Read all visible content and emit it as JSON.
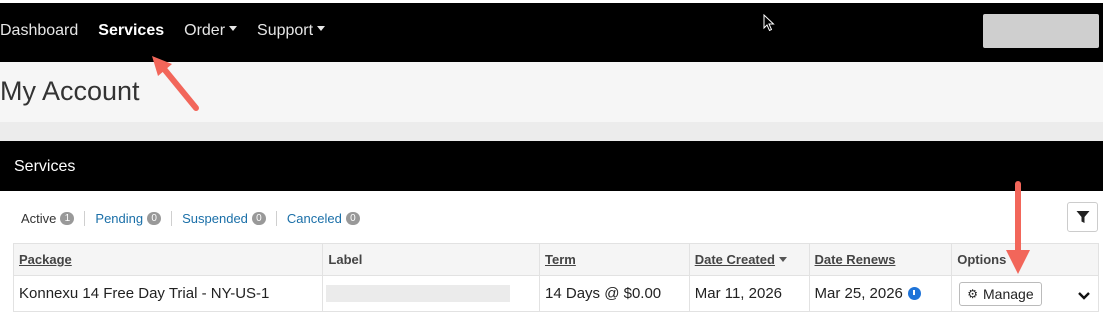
{
  "nav": {
    "items": [
      {
        "label": "Dashboard",
        "dropdown": false
      },
      {
        "label": "Services",
        "dropdown": false,
        "active": true
      },
      {
        "label": "Order",
        "dropdown": true
      },
      {
        "label": "Support",
        "dropdown": true
      }
    ]
  },
  "page": {
    "title": "My Account"
  },
  "services_panel": {
    "title": "Services"
  },
  "filters": [
    {
      "label": "Active",
      "count": "1"
    },
    {
      "label": "Pending",
      "count": "0"
    },
    {
      "label": "Suspended",
      "count": "0"
    },
    {
      "label": "Canceled",
      "count": "0"
    }
  ],
  "table": {
    "headers": [
      "Package",
      "Label",
      "Term",
      "Date Created",
      "Date Renews",
      "Options"
    ],
    "rows": [
      {
        "package": "Konnexu 14 Free Day Trial - NY-US-1",
        "label": "",
        "term": "14 Days @ $0.00",
        "date_created": "Mar 11, 2026",
        "date_renews": "Mar 25, 2026",
        "manage_label": "Manage"
      }
    ]
  },
  "icons": {
    "cursor": "mouse-pointer-icon",
    "filter": "filter-funnel-icon",
    "clock": "clock-icon",
    "gear": "gear-icon",
    "expand": "chevron-down-icon",
    "annotation_arrow": "red-arrow-icon"
  },
  "colors": {
    "topbar": "#000000",
    "link": "#1a6fa8",
    "annotation": "#f2665a",
    "clock": "#1e73d8"
  }
}
